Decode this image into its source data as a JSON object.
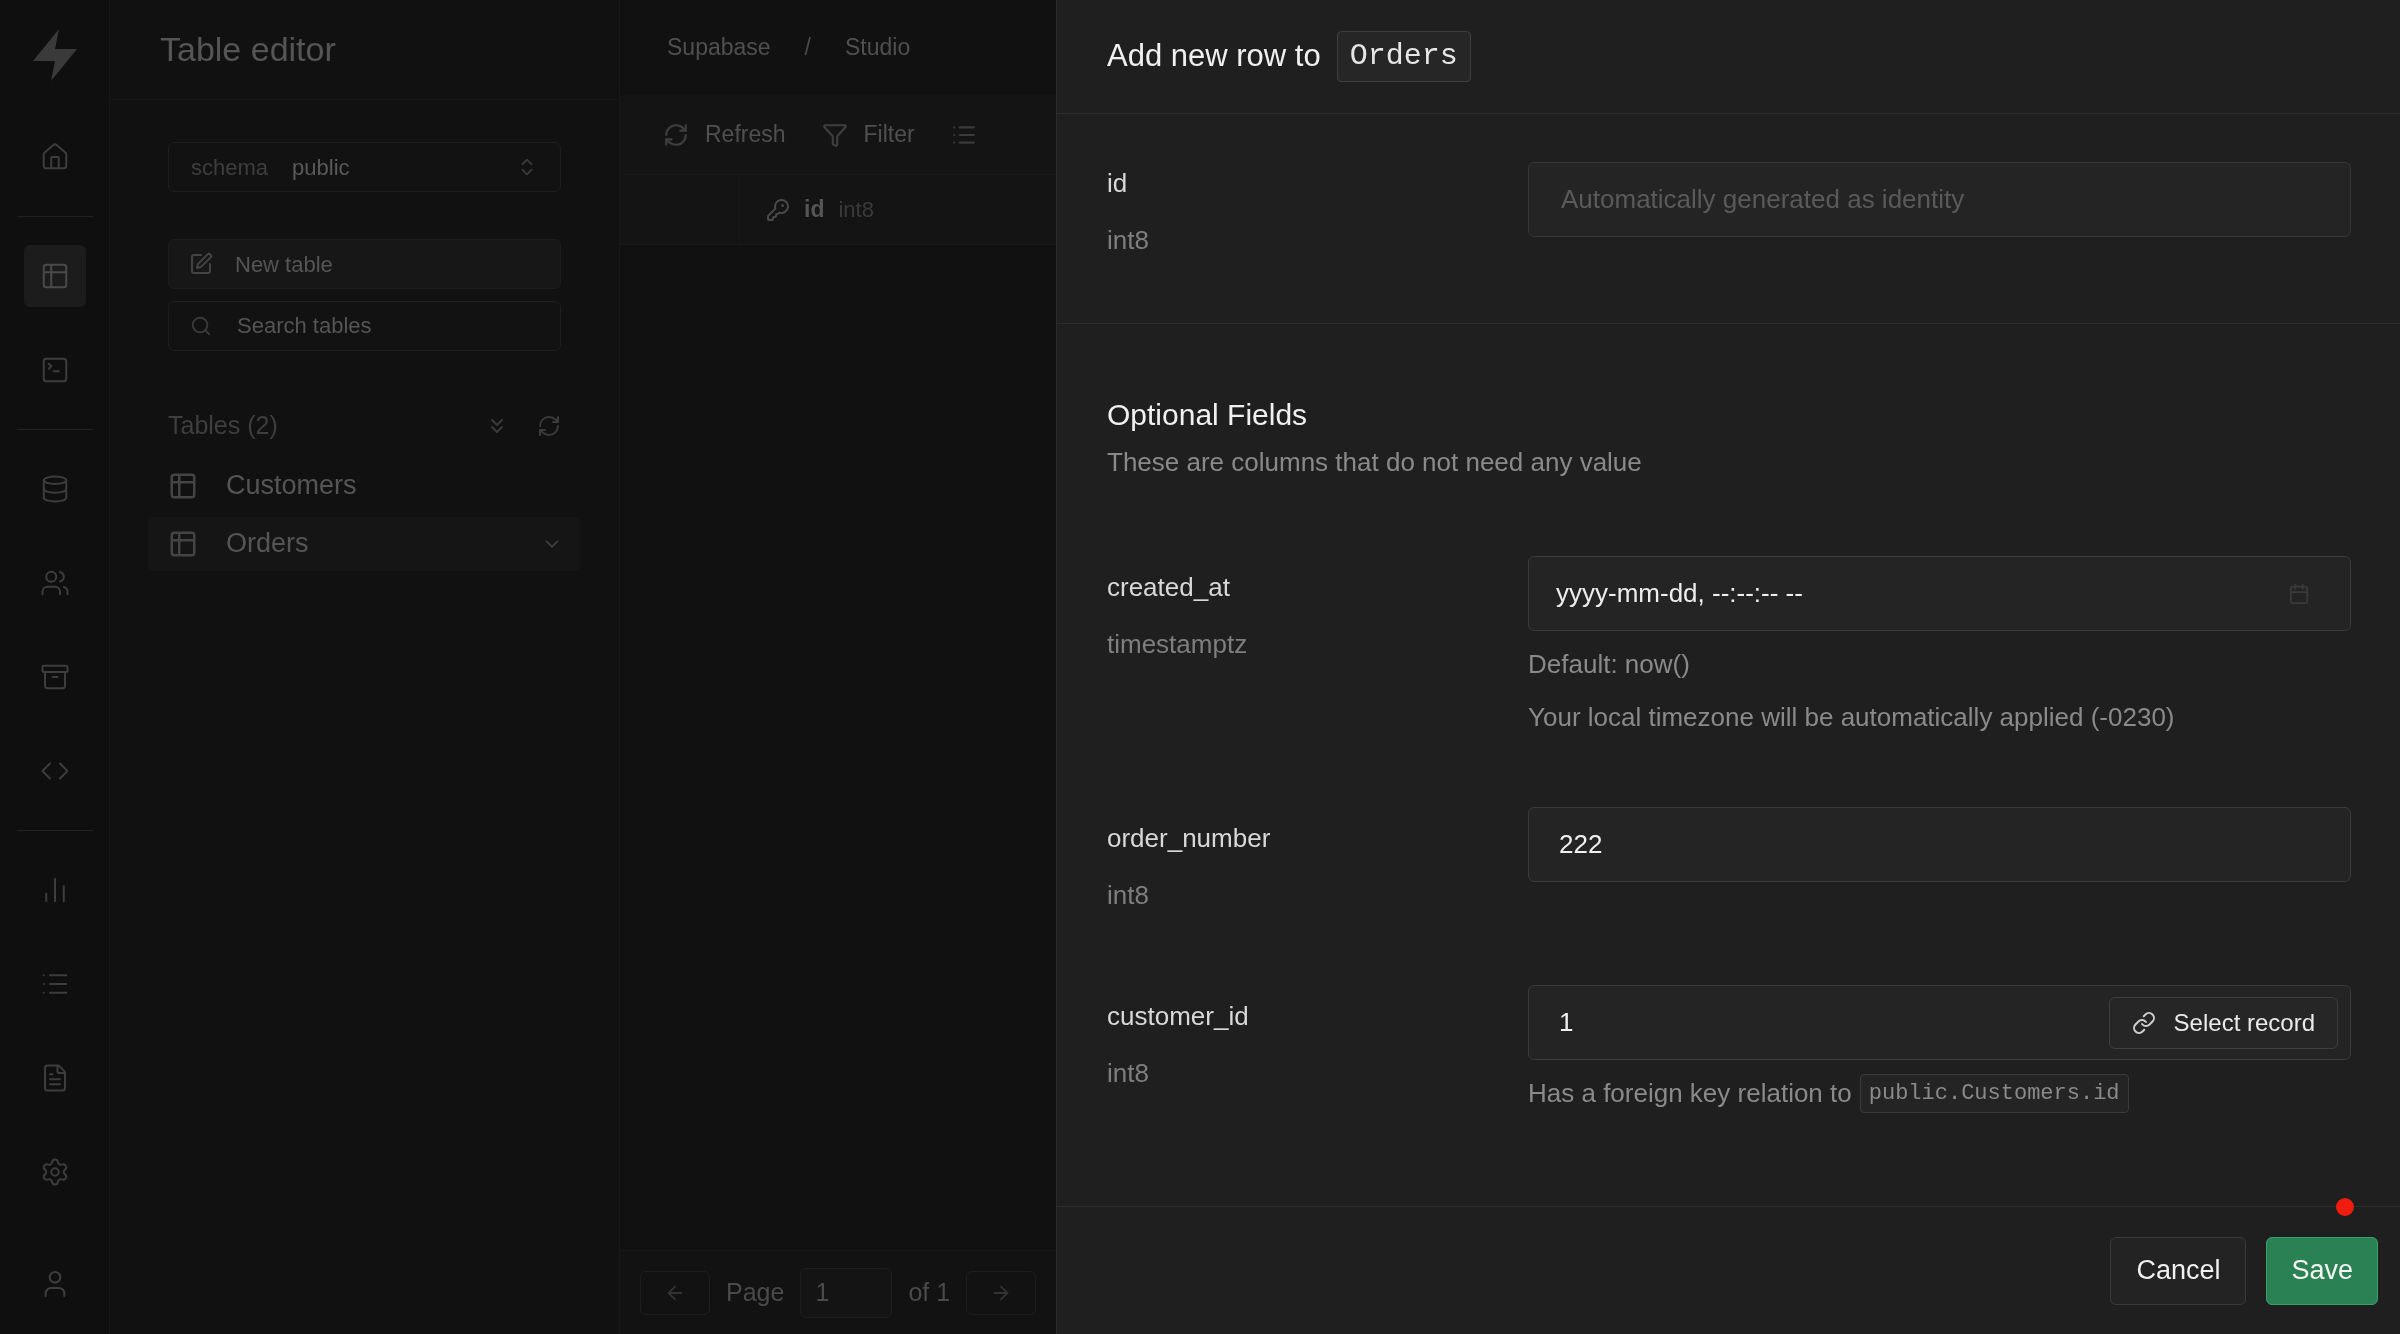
{
  "nav_rail": {
    "groups": [
      [
        {
          "kind": "home",
          "selected": false
        }
      ],
      [
        {
          "kind": "table",
          "selected": true
        },
        {
          "kind": "terminal",
          "selected": false
        }
      ],
      [
        {
          "kind": "database",
          "selected": false
        },
        {
          "kind": "users",
          "selected": false
        },
        {
          "kind": "archive",
          "selected": false
        },
        {
          "kind": "code",
          "selected": false
        }
      ],
      [
        {
          "kind": "chart",
          "selected": false
        },
        {
          "kind": "list",
          "selected": false
        },
        {
          "kind": "file",
          "selected": false
        },
        {
          "kind": "settings",
          "selected": false
        }
      ]
    ]
  },
  "sidebar": {
    "title": "Table editor",
    "schema": {
      "label": "schema",
      "value": "public"
    },
    "new_table": "New table",
    "search": {
      "placeholder": "Search tables"
    },
    "tables_heading": "Tables (2)",
    "tables": [
      {
        "name": "Customers",
        "selected": false
      },
      {
        "name": "Orders",
        "selected": true
      }
    ]
  },
  "breadcrumb": {
    "items": [
      "Supabase",
      "Studio"
    ],
    "separator": "/"
  },
  "toolbar": [
    {
      "kind": "refresh",
      "label": "Refresh"
    },
    {
      "kind": "filter",
      "label": "Filter"
    }
  ],
  "grid": {
    "columns": [
      {
        "name": "id",
        "type": "int8",
        "primary_key": true
      }
    ]
  },
  "pagination": {
    "label": "Page",
    "page": "1",
    "total": "of 1"
  },
  "panel": {
    "title": "Add new row to",
    "table": "Orders",
    "required_fields": [
      {
        "name": "id",
        "type": "int8",
        "placeholder": "Automatically generated as identity"
      }
    ],
    "optional_heading": "Optional Fields",
    "optional_subtitle": "These are columns that do not need any value",
    "optional_fields": [
      {
        "kind": "datetime",
        "name": "created_at",
        "type": "timestamptz",
        "display": "yyyy-mm-dd, --:--:-- --",
        "notes": [
          "Default: now()",
          "Your local timezone will be automatically applied (-0230)"
        ]
      },
      {
        "kind": "number",
        "name": "order_number",
        "type": "int8",
        "value": "222"
      },
      {
        "kind": "foreign_key",
        "name": "customer_id",
        "type": "int8",
        "value": "1",
        "button": "Select record",
        "relation_text": "Has a foreign key relation to",
        "relation": "public.Customers.id"
      }
    ],
    "buttons": {
      "cancel": "Cancel",
      "save": "Save"
    }
  }
}
